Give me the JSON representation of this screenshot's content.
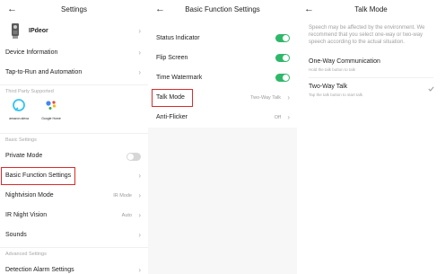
{
  "p1": {
    "title": "Settings",
    "device_name": "IPdeor",
    "items": [
      {
        "label": "Device Information"
      },
      {
        "label": "Tap-to-Run and Automation"
      }
    ],
    "third_party_section": "Third Party Supported",
    "alexa_caption": "amazon alexa",
    "google_caption": "Google Home",
    "basic_section": "Basic Settings",
    "private_mode": "Private Mode",
    "basic_function": "Basic Function Settings",
    "nightvision": {
      "label": "Nightvision Mode",
      "value": "IR Mode"
    },
    "ir_night": {
      "label": "IR Night Vision",
      "value": "Auto"
    },
    "sounds": "Sounds",
    "advanced_section": "Advanced Settings",
    "detection": "Detection Alarm Settings"
  },
  "p2": {
    "title": "Basic Function Settings",
    "status": "Status Indicator",
    "flip": "Flip Screen",
    "watermark": "Time Watermark",
    "talk": {
      "label": "Talk Mode",
      "value": "Two-Way Talk"
    },
    "flicker": {
      "label": "Anti-Flicker",
      "value": "Off"
    }
  },
  "p3": {
    "title": "Talk Mode",
    "note": "Speech may be affected by the environment. We recommend that you select one-way or two-way speech according to the actual situation.",
    "one_way": {
      "title": "One-Way Communication",
      "sub": "Hold the talk button to talk"
    },
    "two_way": {
      "title": "Two-Way Talk",
      "sub": "Tap the talk button to start talk"
    }
  },
  "icons": {
    "back": "back-arrow-icon",
    "chevron": "chevron-right-icon",
    "check": "checkmark-icon",
    "device": "camera-device-icon",
    "alexa": "amazon-alexa-icon",
    "google": "google-assistant-icon"
  },
  "colors": {
    "toggle_on": "#2fb86a",
    "toggle_off": "#d7d7d7",
    "highlight": "#d82c2c",
    "check": "#9a9a9a"
  }
}
